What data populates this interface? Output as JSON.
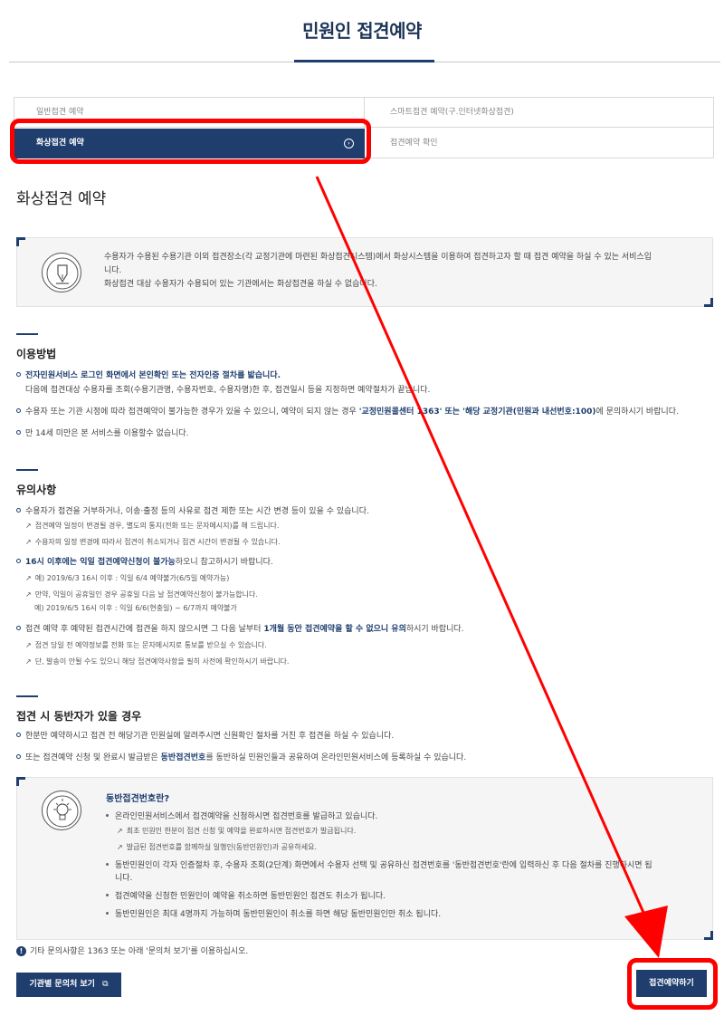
{
  "header": {
    "title": "민원인 접견예약"
  },
  "tabs": {
    "general": "일반접견 예약",
    "smart": "스마트접견 예약(구.인터넷화상접견)",
    "video": "화상접견 예약",
    "confirm": "접견예약 확인"
  },
  "section": {
    "title": "화상접견 예약"
  },
  "intro": {
    "line1": "수용자가 수용된 수용기관 이외 접견장소(각 교정기관에 마련된 화상접견시스템)에서 화상시스템을 이용하여 접견하고자 할 때 접견 예약을 하실 수 있는 서비스입",
    "line2": "니다.",
    "line3": "화상접견 대상 수용자가 수용되어 있는 기관에서는 화상접견을 하실 수 없습니다."
  },
  "usage": {
    "heading": "이용방법",
    "b1_blue": "전자민원서비스 로그인 화면에서 본인확인 또는 전자인증 절차를 밟습니다.",
    "b1_line2": "다음에 접견대상 수용자를 조회(수용기관명, 수용자번호, 수용자명)한 후, 접견일시 등을 지정하면 예약절차가 끝납니다.",
    "b2_pre": "수용자 또는 기관 시정에 따라 접견예약이 불가능한 경우가 있을 수 있으니, 예약이 되지 않는 경우 ",
    "b2_blue": "'교정민원콜센터 1363' 또는 '해당 교정기관(민원과 내선번호:100)",
    "b2_post": "에 문의하시기 바랍니다.",
    "b3": "만 14세 미만은 본 서비스를 이용할수 없습니다."
  },
  "notes": {
    "heading": "유의사항",
    "n1": "수용자가 접견을 거부하거나, 이송·출정 등의 사유로 접견 제한 또는 시간 변경 등이 있을 수 있습니다.",
    "n1_s1": "접견예약 일정이 변경될 경우, 별도의 통지(전화 또는 문자메시지)를 해 드립니다.",
    "n1_s2": "수용자의 일정 변경에 따라서 접견이 취소되거나 접견 시간이 변경될 수 있습니다.",
    "n2_blue": "16시 이후에는 익일 접견예약신청이 불가능",
    "n2_post": "하오니 참고하시기 바랍니다.",
    "n2_s1": "예) 2019/6/3 16시 이후 : 익일 6/4 예약불가(6/5일 예약가능)",
    "n2_s2": "만약, 익일이 공휴일인 경우 공휴일 다음 날 접견예약신청이 불가능합니다.",
    "n2_s3": "예) 2019/6/5 16시 이후 : 익일 6/6(현충일) ~ 6/7까지 예약불가",
    "n3_pre": "접견 예약 후 예약된 접견시간에 접견을 하지 않으시면 그 다음 날부터 ",
    "n3_blue": "1개월 동안 접견예약을 할 수 없으니 유의",
    "n3_post": "하시기 바랍니다.",
    "n3_s1": "접견 당일 전 예약정보를 전화 또는 문자메시지로 통보를 받으실 수 있습니다.",
    "n3_s2": "단, 발송이 안될 수도 있으니 해당 접견예약사항을 필히 사전에 확인하시기 바랍니다."
  },
  "companion": {
    "heading": "접견 시 동반자가 있을 경우",
    "c1": "한분만 예약하시고 접견 전 해당기관 민원실에 알려주시면 신원확인 절차를 거친 후 접견을 하실 수 있습니다.",
    "c2_pre": "또는 접견예약 신청 및 완료시 발급받은 ",
    "c2_blue": "동반접견번호",
    "c2_post": "를 동반하실 민원인들과 공유하여 온라인민원서비스에 등록하실 수 있습니다."
  },
  "companion_box": {
    "title": "동반접견번호란?",
    "b1": "온라인민원서비스에서 접견예약을 신청하시면 접견번호를 발급하고 있습니다.",
    "b1_s1": "최초 민원인 한분이 접견 신청 및 예약을 완료하시면 접견번호가 발급됩니다.",
    "b1_s2": "발급된 접견번호를 함께하실 일행인(동반민원인)과 공유하세요.",
    "b2_line1": "동반민원인이 각자 인증절차 후, 수용자 조회(2단계) 화면에서 수용자 선택 및 공유하신 접견번호를 '동반접견번호'란에 입력하신 후 다음 절차를 진행하시면 됩",
    "b2_line2": "니다.",
    "b3": "접견예약을 신청한 민원인이 예약을 취소하면 동반민원인 접견도 취소가 됩니다.",
    "b4": "동반민원인은 최대 4명까지 가능하며 동반민원인이 취소를 하면 해당 동반민원인만 취소 됩니다."
  },
  "footer": {
    "notice": "기타 문의사항은 1363 또는 아래 '문의처 보기'를 이용하십시오.",
    "contact_button": "기관별 문의처 보기",
    "reserve_button": "접견예약하기"
  },
  "colors": {
    "navy": "#1f3e6e",
    "annotation_red": "#ff0000"
  }
}
